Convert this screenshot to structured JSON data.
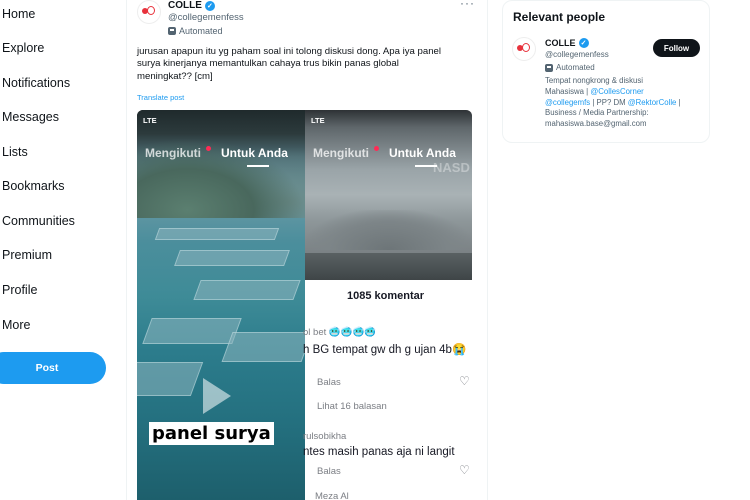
{
  "nav": {
    "items": [
      "Home",
      "Explore",
      "Notifications",
      "Messages",
      "Lists",
      "Bookmarks",
      "Communities",
      "Premium",
      "Profile",
      "More"
    ],
    "post_label": "Post"
  },
  "tweet": {
    "author_name": "COLLE",
    "author_handle": "@collegemenfess",
    "automated_label": "Automated",
    "more": "···",
    "text_line1": "jurusan apapun itu yg paham soal ini tolong diskusi dong. Apa iya panel",
    "text_line2": "surya kinerjanya memantulkan cahaya trus bikin panas global",
    "text_line3": "meningkat?? [cm]",
    "translate_label": "Translate post"
  },
  "media": {
    "left": {
      "status": "LTE",
      "tab_following": "Mengikuti",
      "tab_for_you": "Untuk Anda",
      "caption": "panel surya"
    },
    "right": {
      "status": "LTE",
      "tab_following": "Mengikuti",
      "tab_for_you": "Untuk Anda",
      "watermark": "NASD",
      "comments_count": "1085 komentar",
      "comment1_user": "ol bet 🥶🥶🥶🥶",
      "comment1_text": "h BG tempat gw dh g ujan 4b😭",
      "reply_label": "Balas",
      "view_replies": "Lihat 16 balasan",
      "comment2_user": "rulsobikha",
      "comment2_text": "ntes masih panas aja ni langit",
      "reply_label2": "Balas",
      "comment3_user": "Meza Al"
    }
  },
  "relevant": {
    "title": "Relevant people",
    "name": "COLLE",
    "handle": "@collegemenfess",
    "automated_label": "Automated",
    "follow_label": "Follow",
    "bio_1": "Tempat nongkrong & diskusi",
    "bio_2": "Mahasiswa | ",
    "bio_link1": "@CollesCorner",
    "bio_link2": "@collegemfs",
    "bio_3": " | PP? DM ",
    "bio_link3": "@RektorColle",
    "bio_4": " |",
    "bio_5": "Business / Media Partnership:",
    "bio_6": "mahasiswa.base@gmail.com"
  },
  "colors": {
    "accent": "#1d9bf0",
    "text": "#0f1419",
    "muted": "#536471",
    "follow_bg": "#0f1419",
    "tiktok_red": "#ff2b55"
  }
}
